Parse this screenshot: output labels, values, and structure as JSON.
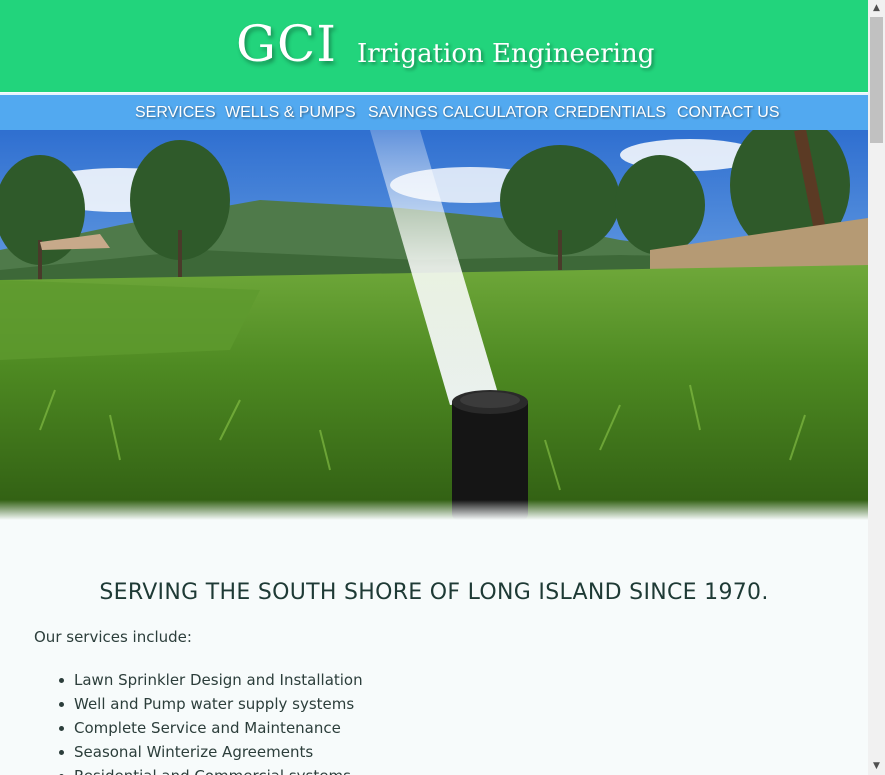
{
  "brand": {
    "logo": "GCI",
    "tagline": "Irrigation Engineering",
    "colors": {
      "header_green": "#22d47c",
      "nav_blue": "#52a9f0"
    }
  },
  "nav": {
    "items": [
      {
        "label": "SERVICES"
      },
      {
        "label": "WELLS & PUMPS"
      },
      {
        "label": "SAVINGS CALCULATOR"
      },
      {
        "label": "CREDENTIALS"
      },
      {
        "label": "CONTACT US"
      }
    ]
  },
  "hero": {
    "subject": "lawn sprinkler spraying water on grass"
  },
  "content": {
    "headline": "SERVING THE SOUTH SHORE OF LONG ISLAND SINCE 1970.",
    "intro": "Our services include:",
    "services": [
      "Lawn Sprinkler Design and Installation",
      "Well and Pump water supply systems",
      "Complete Service and Maintenance",
      "Seasonal Winterize Agreements",
      "Residential and Commercial systems"
    ]
  },
  "scrollbar": {
    "up_icon": "▲",
    "down_icon": "▼"
  }
}
